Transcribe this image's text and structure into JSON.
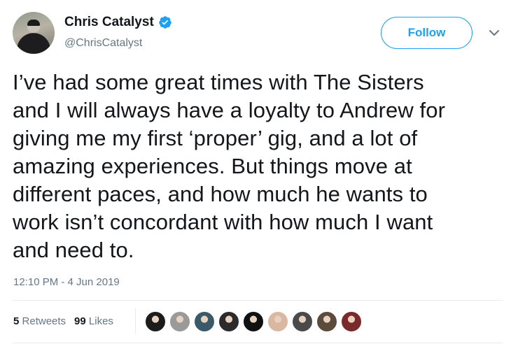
{
  "user": {
    "display_name": "Chris Catalyst",
    "handle": "@ChrisCatalyst",
    "verified": true
  },
  "actions": {
    "follow_label": "Follow"
  },
  "tweet": {
    "lines": [
      "I’ve had some great times with The Sisters",
      "and I will always have a loyalty to Andrew for",
      "giving me my first ‘proper’ gig, and a lot of",
      "amazing experiences. But things move at",
      "different paces, and how much he wants to",
      "work isn’t concordant with how much I want",
      "and need to."
    ],
    "timestamp": "12:10 PM - 4 Jun 2019"
  },
  "stats": {
    "retweets_count": "5",
    "retweets_label": "Retweets",
    "likes_count": "99",
    "likes_label": "Likes"
  },
  "likers": [
    {
      "icon": "liker-avatar-icon",
      "color": "#1c1c1c"
    },
    {
      "icon": "liker-avatar-icon",
      "color": "#9a9a9a"
    },
    {
      "icon": "liker-avatar-icon",
      "color": "#3a5a6a"
    },
    {
      "icon": "liker-avatar-icon",
      "color": "#2b2b2b"
    },
    {
      "icon": "liker-avatar-icon",
      "color": "#111111"
    },
    {
      "icon": "liker-avatar-icon",
      "color": "#d9b7a0"
    },
    {
      "icon": "liker-avatar-icon",
      "color": "#4a4a4a"
    },
    {
      "icon": "liker-avatar-icon",
      "color": "#5c4a3a"
    },
    {
      "icon": "liker-avatar-icon",
      "color": "#7a2a2a"
    }
  ],
  "colors": {
    "accent": "#1da1f2",
    "text": "#14171a",
    "secondary": "#657786"
  }
}
